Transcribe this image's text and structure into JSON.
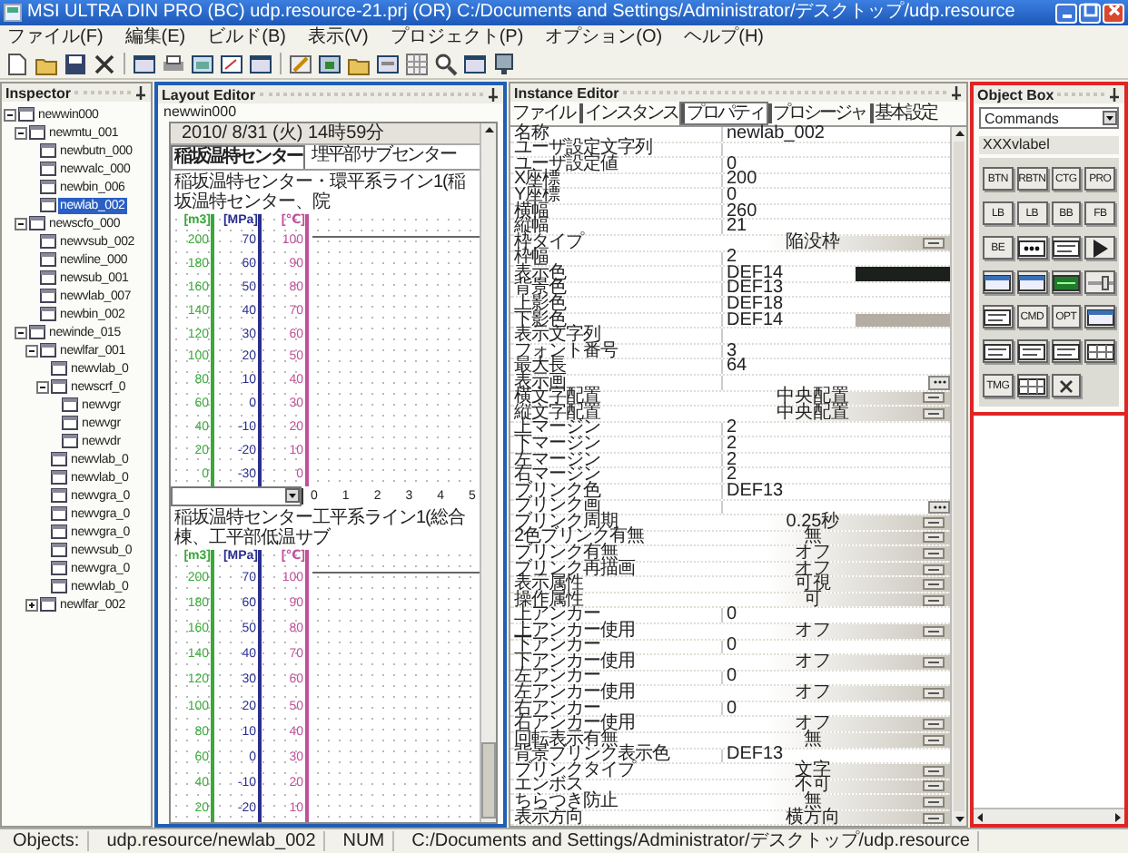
{
  "window": {
    "title": "MSI ULTRA DIN PRO (BC) udp.resource-21.prj (OR) C:/Documents and Settings/Administrator/デスクトップ/udp.resource"
  },
  "menu": [
    "ファイル(F)",
    "編集(E)",
    "ビルド(B)",
    "表示(V)",
    "プロジェクト(P)",
    "オプション(O)",
    "ヘルプ(H)"
  ],
  "inspector": {
    "title": "Inspector",
    "tree": [
      {
        "label": "newwin000",
        "expanded": true,
        "selected": false,
        "children": [
          {
            "label": "newmtu_001",
            "expanded": true,
            "selected": false,
            "children": [
              {
                "label": "newbutn_000",
                "selected": false
              },
              {
                "label": "newvalc_000",
                "selected": false
              },
              {
                "label": "newbin_006",
                "selected": false
              },
              {
                "label": "newlab_002",
                "selected": true
              }
            ]
          },
          {
            "label": "newscfo_000",
            "expanded": true,
            "selected": false,
            "children": [
              {
                "label": "newvsub_002",
                "selected": false
              },
              {
                "label": "newline_000",
                "selected": false
              },
              {
                "label": "newsub_001",
                "selected": false
              },
              {
                "label": "newvlab_007",
                "selected": false
              },
              {
                "label": "newbin_002",
                "selected": false
              }
            ]
          },
          {
            "label": "newinde_015",
            "expanded": true,
            "selected": false,
            "children": [
              {
                "label": "newlfar_001",
                "expanded": true,
                "selected": false,
                "children": [
                  {
                    "label": "newvlab_0",
                    "selected": false
                  },
                  {
                    "label": "newscrf_0",
                    "expanded": true,
                    "selected": false,
                    "children": [
                      {
                        "label": "newvgr",
                        "selected": false
                      },
                      {
                        "label": "newvgr",
                        "selected": false
                      },
                      {
                        "label": "newvdr",
                        "selected": false
                      }
                    ]
                  },
                  {
                    "label": "newvlab_0",
                    "selected": false
                  },
                  {
                    "label": "newvlab_0",
                    "selected": false
                  },
                  {
                    "label": "newvgra_0",
                    "selected": false
                  },
                  {
                    "label": "newvgra_0",
                    "selected": false
                  },
                  {
                    "label": "newvgra_0",
                    "selected": false
                  },
                  {
                    "label": "newvsub_0",
                    "selected": false
                  },
                  {
                    "label": "newvgra_0",
                    "selected": false
                  },
                  {
                    "label": "newvlab_0",
                    "selected": false
                  }
                ]
              },
              {
                "label": "newlfar_002",
                "expanded": false,
                "selected": false
              }
            ]
          }
        ]
      }
    ]
  },
  "layout_editor": {
    "title": "Layout Editor",
    "window_name": "newwin000",
    "date": "2010/ 8/31 (火) 14時59分",
    "tabs": [
      {
        "label": "稲坂温特センター",
        "selected": true
      },
      {
        "label": "埋平部サブセンター",
        "selected": false
      }
    ],
    "trends": [
      {
        "title": "稲坂温特センター・環平系ライン1(稲坂温特センター、院",
        "axes": [
          {
            "unit": "[m3]",
            "color": "#3aa83a",
            "ticks": [
              "200",
              "180",
              "160",
              "140",
              "120",
              "100",
              "80",
              "60",
              "40",
              "20",
              "0"
            ]
          },
          {
            "unit": "[MPa]",
            "color": "#2a2f8f",
            "ticks": [
              "70",
              "60",
              "50",
              "40",
              "30",
              "20",
              "10",
              "0",
              "-10",
              "-20",
              "-30"
            ]
          },
          {
            "unit": "[℃]",
            "color": "#c0509a",
            "ticks": [
              "100",
              "90",
              "80",
              "70",
              "60",
              "50",
              "40",
              "30",
              "20",
              "10",
              "0"
            ]
          }
        ]
      },
      {
        "title": "稲坂温特センター工平系ライン1(総合棟、工平部低温サブ",
        "axes": [
          {
            "unit": "[m3]",
            "color": "#3aa83a",
            "ticks": [
              "200",
              "180",
              "160",
              "140",
              "120",
              "100",
              "80",
              "60",
              "40",
              "20"
            ]
          },
          {
            "unit": "[MPa]",
            "color": "#2a2f8f",
            "ticks": [
              "70",
              "60",
              "50",
              "40",
              "30",
              "20",
              "10",
              "0",
              "-10",
              "-20"
            ]
          },
          {
            "unit": "[℃]",
            "color": "#c0509a",
            "ticks": [
              "100",
              "90",
              "80",
              "70",
              "60",
              "50",
              "40",
              "30",
              "20",
              "10"
            ]
          }
        ]
      }
    ],
    "x_ticks": [
      "0",
      "1",
      "2",
      "3",
      "4",
      "5"
    ]
  },
  "instance_editor": {
    "title": "Instance Editor",
    "menu": "ファイル",
    "tabs": [
      {
        "label": "インスタンス",
        "selected": false
      },
      {
        "label": "プロパティ",
        "selected": true
      },
      {
        "label": "プロシージャ",
        "selected": false
      },
      {
        "label": "基本設定",
        "selected": false
      }
    ],
    "properties": [
      {
        "name": "名称",
        "kind": "text",
        "value": "newlab_002"
      },
      {
        "name": "ユーザ設定文字列",
        "kind": "text"
      },
      {
        "name": "ユーザ設定値",
        "kind": "text",
        "value": "0"
      },
      {
        "name": "X座標",
        "kind": "text",
        "value": "200"
      },
      {
        "name": "Y座標",
        "kind": "text",
        "value": "0"
      },
      {
        "name": "横幅",
        "kind": "text",
        "value": "260"
      },
      {
        "name": "縦幅",
        "kind": "text",
        "value": "21"
      },
      {
        "name": "枠タイプ",
        "kind": "select",
        "value": "陥没枠"
      },
      {
        "name": "枠幅",
        "kind": "text",
        "value": "2"
      },
      {
        "name": "表示色",
        "kind": "color",
        "value": "DEF14",
        "color": "#1b201d"
      },
      {
        "name": "背景色",
        "kind": "text",
        "value": "DEF13"
      },
      {
        "name": "上影色",
        "kind": "text",
        "value": "DEF18"
      },
      {
        "name": "下影色",
        "kind": "color",
        "value": "DEF14",
        "color": "#b3ada3"
      },
      {
        "name": "表示文字列",
        "kind": "text"
      },
      {
        "name": "フォント番号",
        "kind": "text",
        "value": "3"
      },
      {
        "name": "最大長",
        "kind": "text",
        "value": "64"
      },
      {
        "name": "表示画",
        "kind": "picker"
      },
      {
        "name": "横文字配置",
        "kind": "select",
        "value": "中央配置"
      },
      {
        "name": "縦文字配置",
        "kind": "select",
        "value": "中央配置"
      },
      {
        "name": "上マージン",
        "kind": "text",
        "value": "2"
      },
      {
        "name": "下マージン",
        "kind": "text",
        "value": "2"
      },
      {
        "name": "左マージン",
        "kind": "text",
        "value": "2"
      },
      {
        "name": "右マージン",
        "kind": "text",
        "value": "2"
      },
      {
        "name": "ブリンク色",
        "kind": "text",
        "value": "DEF13"
      },
      {
        "name": "ブリンク画",
        "kind": "picker"
      },
      {
        "name": "ブリンク周期",
        "kind": "select",
        "value": "0.25秒"
      },
      {
        "name": "2色ブリンク有無",
        "kind": "select",
        "value": "無"
      },
      {
        "name": "ブリンク有無",
        "kind": "select",
        "value": "オフ"
      },
      {
        "name": "ブリンク再描画",
        "kind": "select",
        "value": "オフ"
      },
      {
        "name": "表示属性",
        "kind": "select",
        "value": "可視"
      },
      {
        "name": "操作属性",
        "kind": "select",
        "value": "可"
      },
      {
        "name": "上アンカー",
        "kind": "text",
        "value": "0"
      },
      {
        "name": "上アンカー使用",
        "kind": "select",
        "value": "オフ"
      },
      {
        "name": "下アンカー",
        "kind": "text",
        "value": "0"
      },
      {
        "name": "下アンカー使用",
        "kind": "select",
        "value": "オフ"
      },
      {
        "name": "左アンカー",
        "kind": "text",
        "value": "0"
      },
      {
        "name": "左アンカー使用",
        "kind": "select",
        "value": "オフ"
      },
      {
        "name": "右アンカー",
        "kind": "text",
        "value": "0"
      },
      {
        "name": "右アンカー使用",
        "kind": "select",
        "value": "オフ"
      },
      {
        "name": "回転表示有無",
        "kind": "select",
        "value": "無"
      },
      {
        "name": "背景ブリンク表示色",
        "kind": "text",
        "value": "DEF13"
      },
      {
        "name": "ブリンクタイプ",
        "kind": "select",
        "value": "文字"
      },
      {
        "name": "エンボス",
        "kind": "select",
        "value": "不可"
      },
      {
        "name": "ちらつき防止",
        "kind": "select",
        "value": "無"
      },
      {
        "name": "表示方向",
        "kind": "select",
        "value": "横方向"
      }
    ]
  },
  "object_box": {
    "title": "Object Box",
    "category": "Commands",
    "selection": "XXXvlabel",
    "tools": [
      {
        "kind": "text",
        "label": "BTN"
      },
      {
        "kind": "text",
        "label": "RBTN"
      },
      {
        "kind": "text",
        "label": "CTG"
      },
      {
        "kind": "text",
        "label": "PRO"
      },
      {
        "kind": "text",
        "label": "LB"
      },
      {
        "kind": "text",
        "label": "LB"
      },
      {
        "kind": "text",
        "label": "BB"
      },
      {
        "kind": "text",
        "label": "FB"
      },
      {
        "kind": "text",
        "label": "BE"
      },
      {
        "kind": "dots"
      },
      {
        "kind": "list"
      },
      {
        "kind": "play"
      },
      {
        "kind": "window"
      },
      {
        "kind": "window"
      },
      {
        "kind": "gauge"
      },
      {
        "kind": "slider"
      },
      {
        "kind": "list"
      },
      {
        "kind": "text",
        "label": "CMD"
      },
      {
        "kind": "text",
        "label": "OPT"
      },
      {
        "kind": "window"
      },
      {
        "kind": "list"
      },
      {
        "kind": "list"
      },
      {
        "kind": "list"
      },
      {
        "kind": "grid"
      },
      {
        "kind": "text",
        "label": "TMG"
      },
      {
        "kind": "grid"
      },
      {
        "kind": "close"
      }
    ]
  },
  "status_bar": [
    "Objects:",
    "udp.resource/newlab_002",
    "NUM",
    "C:/Documents and Settings/Administrator/デスクトップ/udp.resource"
  ]
}
